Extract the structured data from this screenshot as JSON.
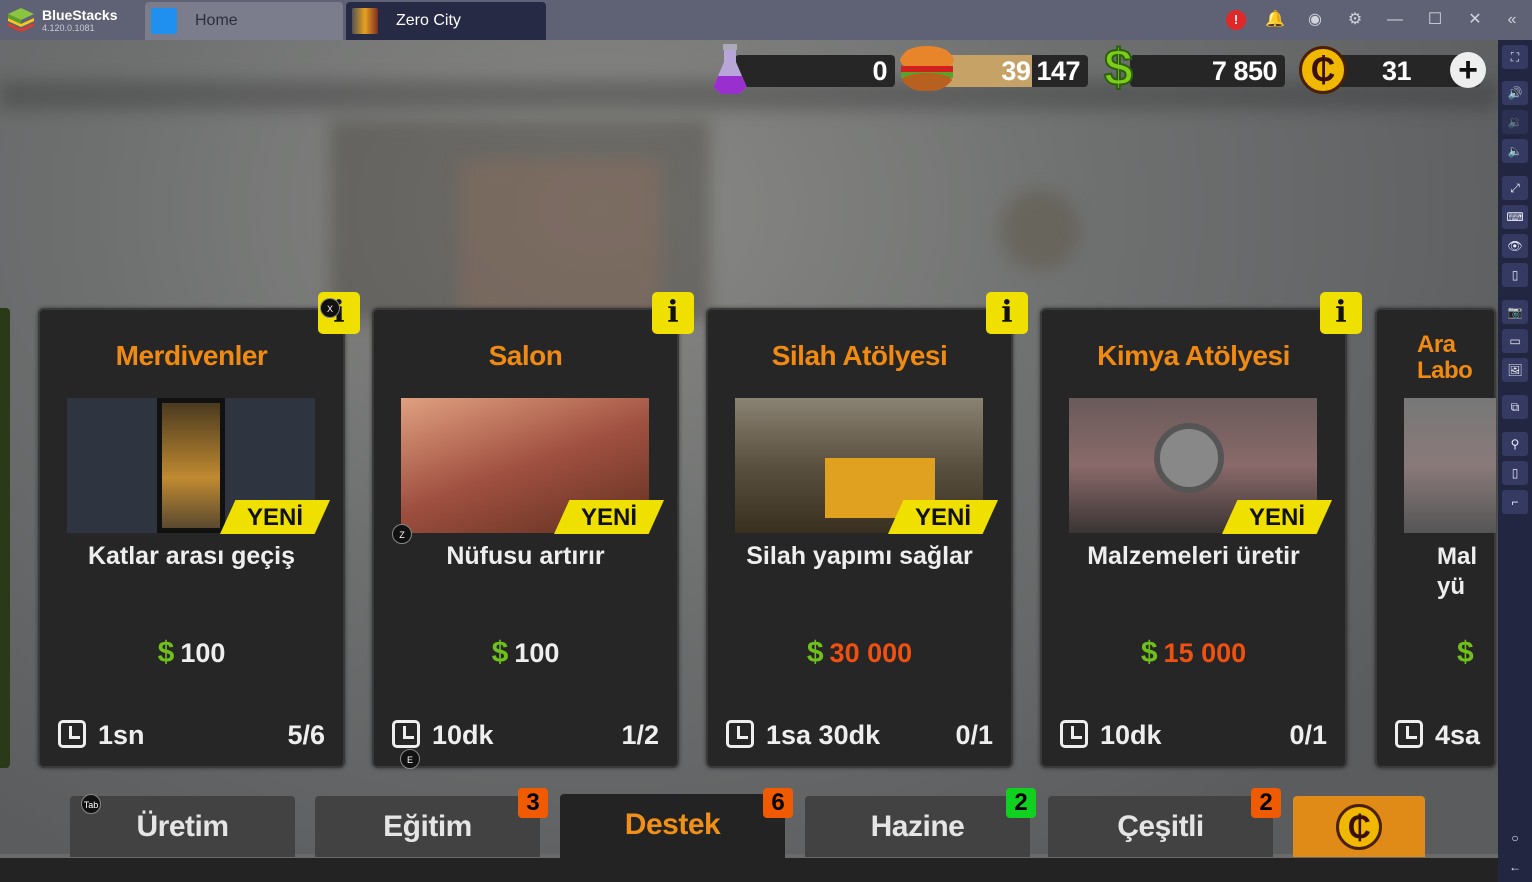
{
  "window": {
    "brand": "BlueStacks",
    "version": "4.120.0.1081",
    "tabs": [
      {
        "label": "Home"
      },
      {
        "label": "Zero City"
      }
    ]
  },
  "resources": {
    "flask": "0",
    "food_current": "39",
    "food_max": "147",
    "money": "7 850",
    "coins": "31"
  },
  "cards": [
    {
      "title": "Merdivenler",
      "badge": "YENİ",
      "desc": "Katlar arası geçiş",
      "price": "100",
      "time": "1sn",
      "count": "5/6",
      "price_color": "#eeeeee"
    },
    {
      "title": "Salon",
      "badge": "YENİ",
      "desc": "Nüfusu artırır",
      "price": "100",
      "time": "10dk",
      "count": "1/2",
      "price_color": "#eeeeee"
    },
    {
      "title": "Silah Atölyesi",
      "badge": "YENİ",
      "desc": "Silah yapımı sağlar",
      "price": "30 000",
      "time": "1sa 30dk",
      "count": "0/1",
      "price_color": "#f05010"
    },
    {
      "title": "Kimya Atölyesi",
      "badge": "YENİ",
      "desc": "Malzemeleri üretir",
      "price": "15 000",
      "time": "10dk",
      "count": "0/1",
      "price_color": "#f05010"
    },
    {
      "title": "Ara Labo",
      "desc": "Mal yü",
      "time": "4sa"
    }
  ],
  "keys": {
    "x": "X",
    "z": "Z",
    "e": "E",
    "tab": "Tab"
  },
  "tabs": [
    {
      "label": "Üretim"
    },
    {
      "label": "Eğitim",
      "badge": "3",
      "badge_color": "#f05a00"
    },
    {
      "label": "Destek",
      "badge": "6",
      "badge_color": "#f05a00",
      "active": true
    },
    {
      "label": "Hazine",
      "badge": "2",
      "badge_color": "#10d020"
    },
    {
      "label": "Çeşitli",
      "badge": "2",
      "badge_color": "#f05a00"
    }
  ],
  "info_symbol": "i",
  "currency_symbol": "$",
  "coin_symbol": "₵"
}
